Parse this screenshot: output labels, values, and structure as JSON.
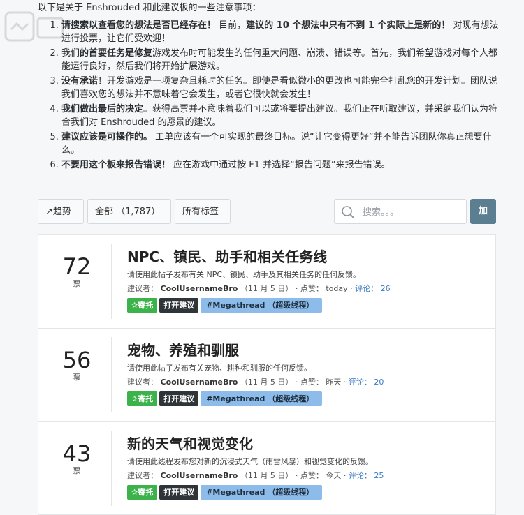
{
  "intro": {
    "heading": "以下是关于 Enshrouded 和此建议板的一些注意事项：",
    "notes": [
      {
        "bold": "请搜索以查看您的想法是否已经存在！",
        "text": " 目前，",
        "bold2": "建议的 10 个想法中只有不到 1 个实际上是新的！",
        "text2": " 对现有想法进行投票，让它们受欢迎！"
      },
      {
        "pre": "我们",
        "bold": "的首要任务是修复",
        "text": "游戏发布时可能发生的任何重大问题、崩溃、错误等。首先，我们希望游戏对每个人都能运行良好，然后我们将开始扩展游戏。"
      },
      {
        "bold": "没有承诺",
        "text": "！开发游戏是一项复杂且耗时的任务。即使是看似微小的更改也可能完全打乱您的开发计划。团队说我们喜欢您的想法并不意味着它会发生，或者它很快就会发生！"
      },
      {
        "bold": "我们做出最后的决定",
        "text": "。获得高票并不意味着我们可以或将要提出建议。我们正在听取建议，并采纳我们认为符合我们对 Enshrouded 的愿景的建议。"
      },
      {
        "bold": "建议应该是可操作的。",
        "text": " 工单应该有一个可实现的最终目标。说“让它变得更好”并不能告诉团队你真正想要什么。"
      },
      {
        "bold": "不要用这个板来报告错误！",
        "text": " 应在游戏中通过按 F1 并选择“报告问题”来报告错误。"
      }
    ]
  },
  "toolbar": {
    "sort_label": "↗趋势",
    "filter_label": "全部 （1,787）",
    "tags_label": "所有标签",
    "search_placeholder": "搜索。。。",
    "add_label": "加"
  },
  "cards": [
    {
      "votes": "72",
      "votes_label": "票",
      "title": "NPC、镇民、助手和相关任务线",
      "desc": "请使用此帖子发布有关 NPC、镇民、助手及其相关任务的任何反馈。",
      "meta_prefix": "建议者：",
      "author": "CoolUsernameBro",
      "date": "（11 月 5 日）",
      "liked": "· 点赞： today ·",
      "comments": "评论： 26",
      "tag_pin": "寄托",
      "tag_open": "打开建议",
      "tag_mega": "#Megathread （超级线程）"
    },
    {
      "votes": "56",
      "votes_label": "票",
      "title": "宠物、养殖和驯服",
      "desc": "请使用此帖子发布有关宠物、耕种和驯服的任何反馈。",
      "meta_prefix": "建议者：",
      "author": "CoolUsernameBro",
      "date": "（11 月 5 日）",
      "liked": "· 点赞： 昨天 ·",
      "comments": "评论： 20",
      "tag_pin": "寄托",
      "tag_open": "打开建议",
      "tag_mega": "#Megathread （超级线程）"
    },
    {
      "votes": "43",
      "votes_label": "票",
      "title": "新的天气和视觉变化",
      "desc": "请使用此线程发布您对新的沉浸式天气（雨雪风暴）和视觉变化的反馈。",
      "meta_prefix": "建议者：",
      "author": "CoolUsernameBro",
      "date": "（11 月 5 日）",
      "liked": "· 点赞： 今天 ·",
      "comments": "评论： 25",
      "tag_pin": "寄托",
      "tag_open": "打开建议",
      "tag_mega": "#Megathread （超级线程）"
    }
  ],
  "icons": {
    "search": "search-icon",
    "caret": "caret-down-icon",
    "pin": "pin-icon",
    "watermark": "watermark-logo"
  }
}
